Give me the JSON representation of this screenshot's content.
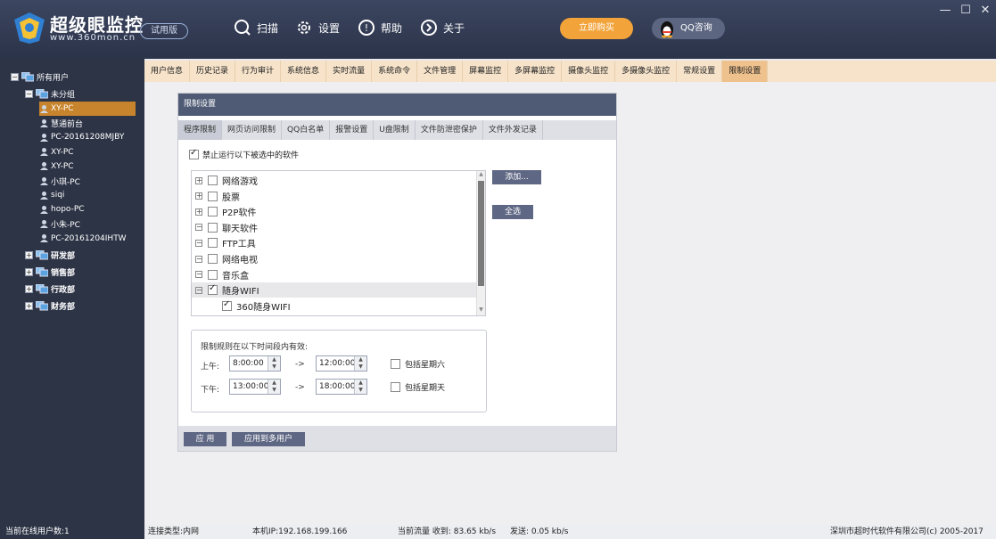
{
  "app": {
    "title": "超级眼监控",
    "url": "www.360mon.cn",
    "trial_badge": "试用版",
    "nav": [
      {
        "label": "扫描",
        "icon": "scan-icon"
      },
      {
        "label": "设置",
        "icon": "gear-icon"
      },
      {
        "label": "帮助",
        "icon": "help-icon"
      },
      {
        "label": "关于",
        "icon": "about-icon"
      }
    ],
    "buy_label": "立即购买",
    "qq_label": "QQ咨询",
    "window_controls": [
      "—",
      "☐",
      "✕"
    ]
  },
  "sidebar": {
    "root": "所有用户",
    "group_ungrouped": "未分组",
    "users": [
      "XY-PC",
      "慧通前台",
      "PC-20161208MJBY",
      "XY-PC",
      "XY-PC",
      "小琪-PC",
      "siqi",
      "hopo-PC",
      "小朱-PC",
      "PC-20161204IHTW"
    ],
    "selected_user_index": 0,
    "groups": [
      "研发部",
      "销售部",
      "行政部",
      "财务部"
    ]
  },
  "main_tabs": [
    "用户信息",
    "历史记录",
    "行为审计",
    "系统信息",
    "实时流量",
    "系统命令",
    "文件管理",
    "屏幕监控",
    "多屏幕监控",
    "摄像头监控",
    "多摄像头监控",
    "常规设置",
    "限制设置"
  ],
  "active_main_tab": "限制设置",
  "panel": {
    "header": "限制设置",
    "sub_tabs": [
      "程序限制",
      "网页访问限制",
      "QQ白名单",
      "报警设置",
      "U盘限制",
      "文件防泄密保护",
      "文件外发记录"
    ],
    "active_sub_tab": "程序限制",
    "forbid_label": "禁止运行以下被选中的软件",
    "forbid_checked": true,
    "software": [
      {
        "label": "网络游戏",
        "expander": "+",
        "checked": false
      },
      {
        "label": "股票",
        "expander": "+",
        "checked": false
      },
      {
        "label": "P2P软件",
        "expander": "+",
        "checked": false
      },
      {
        "label": "聊天软件",
        "expander": "−",
        "checked": false
      },
      {
        "label": "FTP工具",
        "expander": "−",
        "checked": false
      },
      {
        "label": "网络电视",
        "expander": "−",
        "checked": false
      },
      {
        "label": "音乐盒",
        "expander": "−",
        "checked": false
      },
      {
        "label": "随身WIFI",
        "expander": "−",
        "checked": true
      },
      {
        "label": "360随身WIFI",
        "expander": "",
        "checked": true,
        "child": true
      }
    ],
    "add_button": "添加...",
    "select_all_button": "全选",
    "time_rule_label": "限制规则在以下时间段内有效:",
    "morning_label": "上午:",
    "afternoon_label": "下午:",
    "arrow": "->",
    "morning_start": "8:00:00",
    "morning_end": "12:00:00",
    "afternoon_start": "13:00:00",
    "afternoon_end": "18:00:00",
    "include_saturday": "包括星期六",
    "include_sunday": "包括星期天",
    "apply_button": "应 用",
    "apply_multi_button": "应用到多用户"
  },
  "status": {
    "online_users": "当前在线用户数:1",
    "connection": "连接类型:内网",
    "local_ip": "本机IP:192.168.199.166",
    "traffic_in": "当前流量 收到: 83.65 kb/s",
    "traffic_out": "发送: 0.05 kb/s",
    "copyright": "深圳市超时代软件有限公司(c) 2005-2017"
  },
  "colors": {
    "accent": "#f2a33a",
    "sidebar": "#2d3446",
    "selected": "#c8842c",
    "tab_bar": "#f6e3ca"
  }
}
